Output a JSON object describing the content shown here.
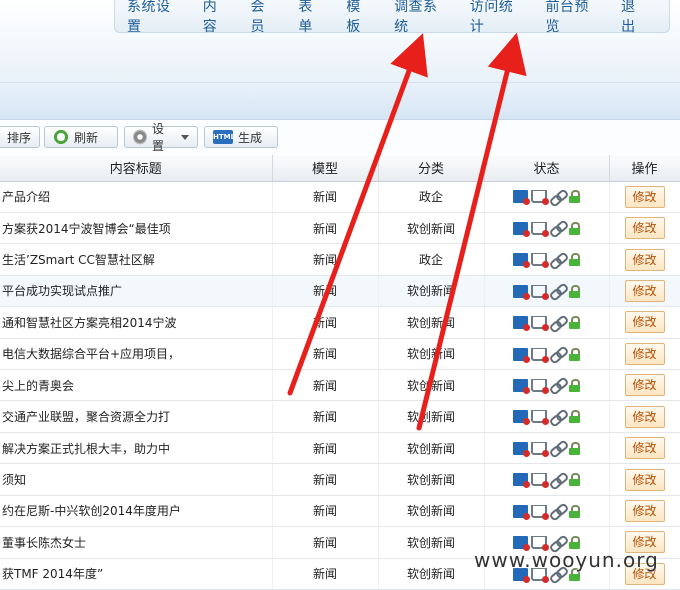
{
  "nav": {
    "items": [
      "系统设置",
      "内容",
      "会员",
      "表单",
      "模板",
      "调查系统",
      "访问统计",
      "前台预览",
      "退出"
    ]
  },
  "toolbar": {
    "sort_label": "排序",
    "refresh_label": "刷新",
    "settings_label": "设置",
    "generate_label": "生成",
    "generate_icon_text": "HTML"
  },
  "table": {
    "headers": [
      "内容标题",
      "模型",
      "分类",
      "状态",
      "操作"
    ],
    "edit_label": "修改",
    "rows": [
      {
        "title": "产品介绍",
        "model": "新闻",
        "category": "政企"
      },
      {
        "title": "方案获2014宁波智博会“最佳项",
        "model": "新闻",
        "category": "软创新闻"
      },
      {
        "title": "生活’ZSmart CC智慧社区解",
        "model": "新闻",
        "category": "政企"
      },
      {
        "title": "平台成功实现试点推广",
        "model": "新闻",
        "category": "软创新闻"
      },
      {
        "title": "通和智慧社区方案亮相2014宁波",
        "model": "新闻",
        "category": "软创新闻"
      },
      {
        "title": "电信大数据综合平台+应用项目，",
        "model": "新闻",
        "category": "软创新闻"
      },
      {
        "title": "尖上的青奥会",
        "model": "新闻",
        "category": "软创新闻"
      },
      {
        "title": "交通产业联盟，聚合资源全力打",
        "model": "新闻",
        "category": "软创新闻"
      },
      {
        "title": "解决方案正式扎根大丰，助力中",
        "model": "新闻",
        "category": "软创新闻"
      },
      {
        "title": "须知",
        "model": "新闻",
        "category": "软创新闻"
      },
      {
        "title": "约在尼斯-中兴软创2014年度用户",
        "model": "新闻",
        "category": "软创新闻"
      },
      {
        "title": "董事长陈杰女士",
        "model": "新闻",
        "category": "软创新闻"
      },
      {
        "title": "获TMF 2014年度”",
        "model": "新闻",
        "category": "软创新闻"
      }
    ]
  },
  "watermark": "www.wooyun.org",
  "colors": {
    "nav_text": "#1f5d99",
    "edit_text": "#b74e00",
    "arrow": "#e8201c"
  }
}
